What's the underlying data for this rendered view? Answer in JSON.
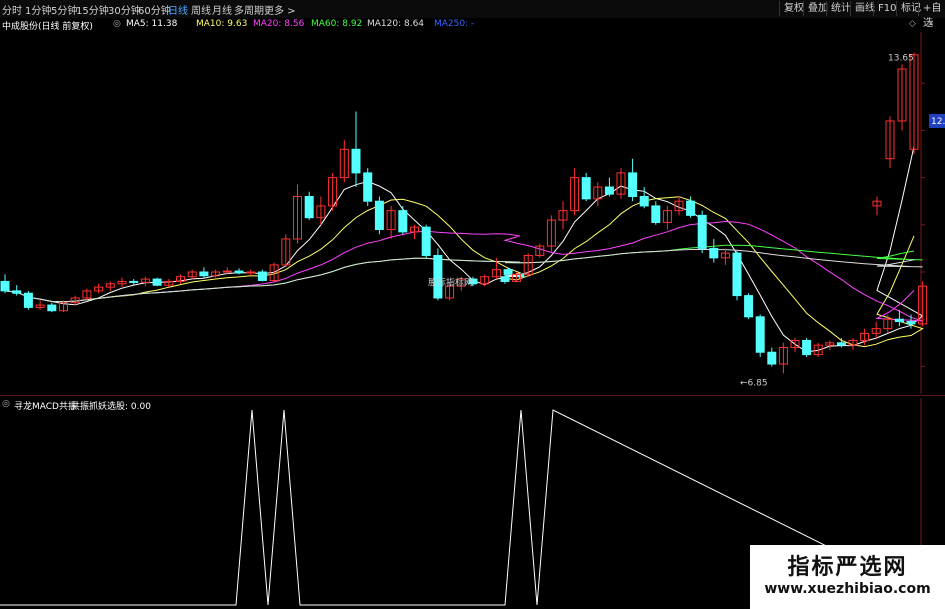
{
  "toolbar": {
    "periods": [
      "分时",
      "1分钟",
      "5分钟",
      "15分钟",
      "30分钟",
      "60分钟",
      "日线",
      "周线",
      "月线",
      "多周期",
      "更多 >"
    ],
    "active_period": "日线",
    "right_buttons": [
      "复权",
      "叠加",
      "统计",
      "画线",
      "F10",
      "标记",
      "+自选"
    ]
  },
  "infobar": {
    "stock": "中成股份(日线 前复权)",
    "ma5": "MA5: 11.38",
    "ma10": "MA10: 9.63",
    "ma20": "MA20: 8.56",
    "ma60": "MA60: 8.92",
    "ma120": "MA120: 8.64",
    "ma250": "MA250: -"
  },
  "colors": {
    "up": "#ff3030",
    "down": "#54ffff",
    "ma5": "#ffffff",
    "ma10": "#ffff66",
    "ma20": "#ff44ff",
    "ma60": "#44ff44",
    "ma120": "#dddddd",
    "ma250": "#3366ff",
    "frame": "#7a1a1a"
  },
  "price_labels": {
    "high": "13.65",
    "low": "6.85",
    "current": "12.",
    "watermark_small": "股标指标网"
  },
  "indicator": {
    "name": "寻龙MACD共振",
    "line_label": "共振抓妖选股: 0.00"
  },
  "watermark": {
    "title": "指标严选网",
    "url": "www.xuezhibiao.com"
  },
  "chart_data": {
    "type": "candlestick",
    "ylim": [
      6.5,
      14.0
    ],
    "candles": [
      [
        8.8,
        8.95,
        8.55,
        8.6
      ],
      [
        8.6,
        8.72,
        8.5,
        8.55
      ],
      [
        8.55,
        8.6,
        8.2,
        8.25
      ],
      [
        8.25,
        8.4,
        8.2,
        8.3
      ],
      [
        8.3,
        8.35,
        8.15,
        8.18
      ],
      [
        8.18,
        8.4,
        8.15,
        8.35
      ],
      [
        8.35,
        8.5,
        8.3,
        8.45
      ],
      [
        8.45,
        8.65,
        8.4,
        8.6
      ],
      [
        8.6,
        8.75,
        8.55,
        8.68
      ],
      [
        8.68,
        8.8,
        8.6,
        8.75
      ],
      [
        8.75,
        8.88,
        8.68,
        8.8
      ],
      [
        8.8,
        8.85,
        8.72,
        8.78
      ],
      [
        8.78,
        8.9,
        8.7,
        8.85
      ],
      [
        8.85,
        8.88,
        8.7,
        8.72
      ],
      [
        8.72,
        8.85,
        8.68,
        8.8
      ],
      [
        8.8,
        8.95,
        8.75,
        8.9
      ],
      [
        8.9,
        9.05,
        8.85,
        9.0
      ],
      [
        9.0,
        9.1,
        8.88,
        8.92
      ],
      [
        8.92,
        9.05,
        8.88,
        9.0
      ],
      [
        9.0,
        9.1,
        8.95,
        9.02
      ],
      [
        9.02,
        9.08,
        8.95,
        8.98
      ],
      [
        8.98,
        9.05,
        8.92,
        9.0
      ],
      [
        9.0,
        9.05,
        8.8,
        8.82
      ],
      [
        8.82,
        9.2,
        8.8,
        9.15
      ],
      [
        9.15,
        9.8,
        9.1,
        9.7
      ],
      [
        9.7,
        10.85,
        9.6,
        10.6
      ],
      [
        10.6,
        10.7,
        10.1,
        10.15
      ],
      [
        10.15,
        10.6,
        10.0,
        10.4
      ],
      [
        10.4,
        11.1,
        10.3,
        11.0
      ],
      [
        11.0,
        11.8,
        10.9,
        11.6
      ],
      [
        11.6,
        12.4,
        10.8,
        11.1
      ],
      [
        11.1,
        11.2,
        10.4,
        10.5
      ],
      [
        10.5,
        10.6,
        9.8,
        9.9
      ],
      [
        9.9,
        10.4,
        9.7,
        10.3
      ],
      [
        10.3,
        10.4,
        9.8,
        9.85
      ],
      [
        9.85,
        10.0,
        9.7,
        9.95
      ],
      [
        9.95,
        10.0,
        9.3,
        9.35
      ],
      [
        9.35,
        9.5,
        8.4,
        8.45
      ],
      [
        8.45,
        8.8,
        8.4,
        8.7
      ],
      [
        8.7,
        8.9,
        8.6,
        8.85
      ],
      [
        8.85,
        8.9,
        8.7,
        8.75
      ],
      [
        8.75,
        8.95,
        8.7,
        8.9
      ],
      [
        8.9,
        9.3,
        8.85,
        9.05
      ],
      [
        9.05,
        9.1,
        8.9,
        8.95
      ],
      [
        8.95,
        9.0,
        8.85,
        8.9
      ],
      [
        8.9,
        8.95,
        8.75,
        8.8
      ],
      [
        8.8,
        9.0,
        8.78,
        8.95
      ],
      [
        8.95,
        9.4,
        8.9,
        9.35
      ],
      [
        9.35,
        9.6,
        9.3,
        9.55
      ],
      [
        9.55,
        10.2,
        9.4,
        10.1
      ],
      [
        10.1,
        10.5,
        9.9,
        10.3
      ],
      [
        10.3,
        11.2,
        10.2,
        11.0
      ],
      [
        11.0,
        11.1,
        10.5,
        10.55
      ],
      [
        10.55,
        10.9,
        10.4,
        10.8
      ],
      [
        10.8,
        11.0,
        10.6,
        10.65
      ],
      [
        10.65,
        11.2,
        10.55,
        11.1
      ],
      [
        11.1,
        11.4,
        10.5,
        10.6
      ],
      [
        10.6,
        10.8,
        10.35,
        10.4
      ],
      [
        10.4,
        10.5,
        10.0,
        10.05
      ],
      [
        10.05,
        10.4,
        9.9,
        10.3
      ],
      [
        10.3,
        10.6,
        10.2,
        10.5
      ],
      [
        10.5,
        10.6,
        10.15,
        10.2
      ],
      [
        10.2,
        10.3,
        9.4,
        9.5
      ],
      [
        9.5,
        9.7,
        9.2,
        9.3
      ],
      [
        9.3,
        9.5,
        9.15,
        9.4
      ],
      [
        9.4,
        9.45,
        8.4,
        8.5
      ],
      [
        8.5,
        8.55,
        8.0,
        8.05
      ],
      [
        8.05,
        8.1,
        7.2,
        7.3
      ],
      [
        7.3,
        7.4,
        7.0,
        7.05
      ],
      [
        7.05,
        7.5,
        6.85,
        7.4
      ],
      [
        7.4,
        7.6,
        7.3,
        7.55
      ],
      [
        7.55,
        7.6,
        7.2,
        7.25
      ],
      [
        7.25,
        7.5,
        7.2,
        7.45
      ],
      [
        7.45,
        7.55,
        7.35,
        7.5
      ],
      [
        7.5,
        7.6,
        7.4,
        7.45
      ],
      [
        7.45,
        7.6,
        7.35,
        7.55
      ],
      [
        7.55,
        7.8,
        7.45,
        7.7
      ],
      [
        7.7,
        7.95,
        7.6,
        7.8
      ],
      [
        7.8,
        8.1,
        7.7,
        8.0
      ],
      [
        8.0,
        8.2,
        7.85,
        7.95
      ],
      [
        7.95,
        8.1,
        7.8,
        7.9
      ],
      [
        7.9,
        8.8,
        7.85,
        8.7
      ],
      [
        10.4,
        10.6,
        10.2,
        10.5
      ],
      [
        11.4,
        12.3,
        11.2,
        12.2
      ],
      [
        12.2,
        13.4,
        12.0,
        13.3
      ],
      [
        11.6,
        13.65,
        11.5,
        13.6
      ]
    ]
  },
  "indicator_data": {
    "type": "line",
    "ylim": [
      0,
      1
    ],
    "x": [
      0,
      236,
      244,
      252,
      260,
      268,
      276,
      284,
      292,
      300,
      505,
      513,
      521,
      529,
      537,
      545,
      553,
      945
    ],
    "values": [
      0,
      0,
      0.5,
      1,
      0.5,
      0,
      0.5,
      1,
      0.5,
      0,
      0,
      0.5,
      1,
      0.5,
      0,
      0.5,
      1,
      0
    ]
  }
}
